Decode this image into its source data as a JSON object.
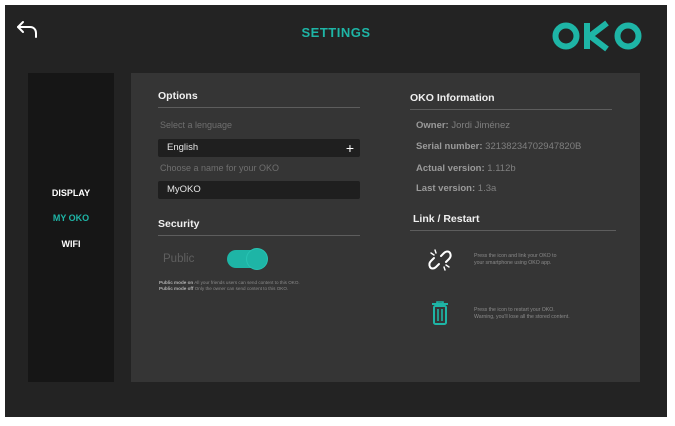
{
  "header": {
    "title": "SETTINGS",
    "logo_text": "OKO",
    "back_icon": "back-arrow-icon",
    "accent_color": "#1eb5a6"
  },
  "sidebar": {
    "items": [
      {
        "label": "DISPLAY",
        "active": false
      },
      {
        "label": "MY OKO",
        "active": true
      },
      {
        "label": "WIFI",
        "active": false
      }
    ]
  },
  "options": {
    "title": "Options",
    "language_label": "Select a lenguage",
    "language_value": "English",
    "add_icon": "plus-icon",
    "name_label": "Choose a name for your OKO",
    "name_value": "MyOKO"
  },
  "security": {
    "title": "Security",
    "mode_label": "Public",
    "toggle_on": true,
    "note_public_key": "Public mode on",
    "note_public_text": "All your friends users can send content to this OKO.",
    "note_private_key": "Public mode off",
    "note_private_text": "Only the owner can send content to this OKO."
  },
  "info": {
    "title": "OKO Information",
    "owner_label": "Owner:",
    "owner_value": "Jordi Jiménez",
    "serial_label": "Serial number:",
    "serial_value": "32138234702947820B",
    "actual_label": "Actual version:",
    "actual_value": "1.112b",
    "last_label": "Last version:",
    "last_value": "1.3a"
  },
  "link_restart": {
    "title": "Link / Restart",
    "link_icon": "link-icon",
    "link_hint_1": "Press the icon and link your OKO to",
    "link_hint_2": "your smartphone using OKO app.",
    "restart_icon": "trash-icon",
    "restart_hint_1": "Press the icon to restart your OKO.",
    "restart_hint_2": "Warning, you'll lose all the stored content."
  }
}
